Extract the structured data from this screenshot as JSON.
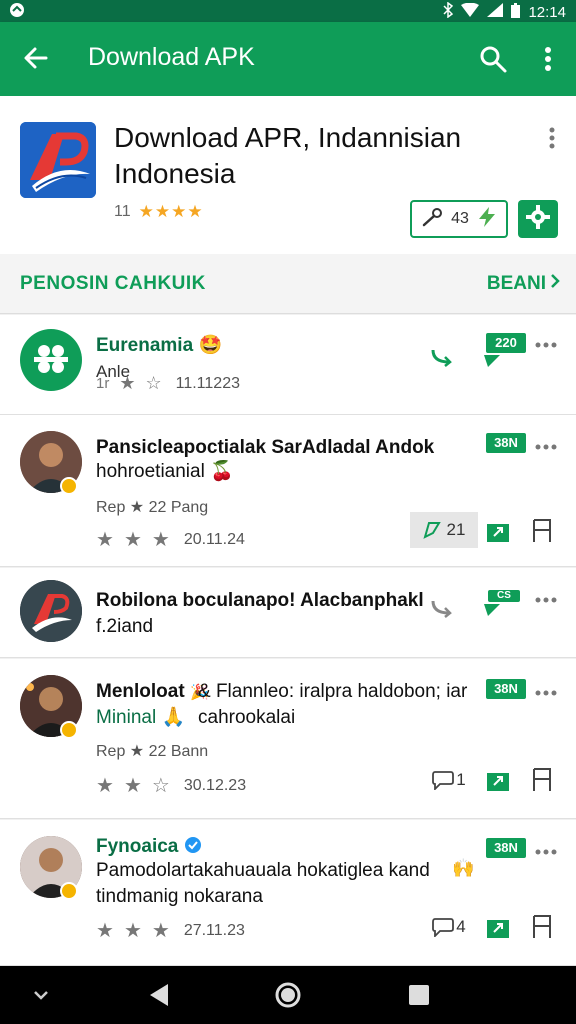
{
  "status": {
    "time": "12:14"
  },
  "appbar": {
    "title": "Download APK"
  },
  "header": {
    "app_title": "Download APR, Indannisian Indonesia",
    "rating_count": "11",
    "stars": "★★★★",
    "pill_value": "43"
  },
  "section": {
    "label": "PENOSIN CAHKUIK",
    "link": "BEANI"
  },
  "reviews": [
    {
      "name": "Eurenamia",
      "body": "Anle",
      "stars_text": "1r",
      "date": "11.11223",
      "tag": "220"
    },
    {
      "name": "Pansicleapoctialak SarAdladal Andok",
      "body": "hohroetianial",
      "meta": "Rep ★ 22 Pang",
      "date": "20.11.24",
      "tag": "38N",
      "like": "21"
    },
    {
      "name": "Robilona boculanapo! Alacbanphakl",
      "body": "f.2iand",
      "tag": "CS"
    },
    {
      "name": "Menloloat",
      "body_a": "& Flannleo: iralpra haldobon; iar cahrookalai ",
      "body_b": "Mininal",
      "meta": "Rep ★ 22 Bann",
      "date": "30.12.23",
      "tag": "38N",
      "like": "1"
    },
    {
      "name": "Fynoaica",
      "body": "Pamodolartakahuauala hokatiglea kand tindmanig nokarana",
      "date": "27.11.23",
      "tag": "38N",
      "like": "4"
    }
  ],
  "colors": {
    "primary": "#0f9d58",
    "statusbar": "#0a6e45",
    "star": "#f5a623"
  }
}
